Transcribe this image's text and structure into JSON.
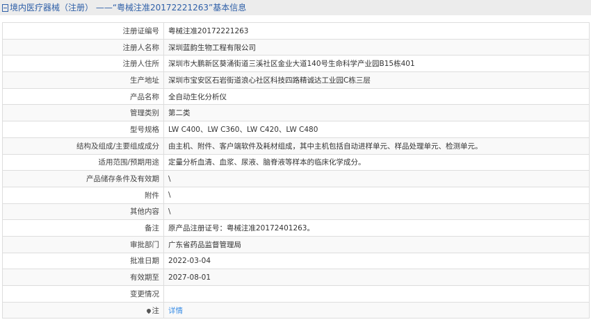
{
  "header": {
    "title": "境内医疗器械（注册） ——“粤械注准20172221263”基本信息"
  },
  "rows": [
    {
      "label": "注册证编号",
      "value": "粤械注准20172221263"
    },
    {
      "label": "注册人名称",
      "value": "深圳蓝韵生物工程有限公司"
    },
    {
      "label": "注册人住所",
      "value": "深圳市大鹏新区葵涌街道三溪社区金业大道140号生命科学产业园B15栋401"
    },
    {
      "label": "生产地址",
      "value": "深圳市宝安区石岩街道浪心社区科技四路精诚达工业园C栋三层"
    },
    {
      "label": "产品名称",
      "value": "全自动生化分析仪"
    },
    {
      "label": "管理类别",
      "value": "第二类"
    },
    {
      "label": "型号规格",
      "value": "LW C400、LW C360、LW C420、LW C480"
    },
    {
      "label": "结构及组成/主要组成成分",
      "value": "由主机、附件、客户端软件及耗材组成，其中主机包括自动进样单元、样品处理单元、检测单元。"
    },
    {
      "label": "适用范围/预期用途",
      "value": "定量分析血清、血浆、尿液、脑脊液等样本的临床化学成分。"
    },
    {
      "label": "产品储存条件及有效期",
      "value": "\\"
    },
    {
      "label": "附件",
      "value": "\\"
    },
    {
      "label": "其他内容",
      "value": "\\"
    },
    {
      "label": "备注",
      "value": "原产品注册证号：粤械注准20172401263。"
    },
    {
      "label": "审批部门",
      "value": "广东省药品监督管理局"
    },
    {
      "label": "批准日期",
      "value": "2022-03-04"
    },
    {
      "label": "有效期至",
      "value": "2027-08-01"
    },
    {
      "label": "变更情况",
      "value": ""
    }
  ],
  "note": {
    "label": "注",
    "link": "详情"
  }
}
